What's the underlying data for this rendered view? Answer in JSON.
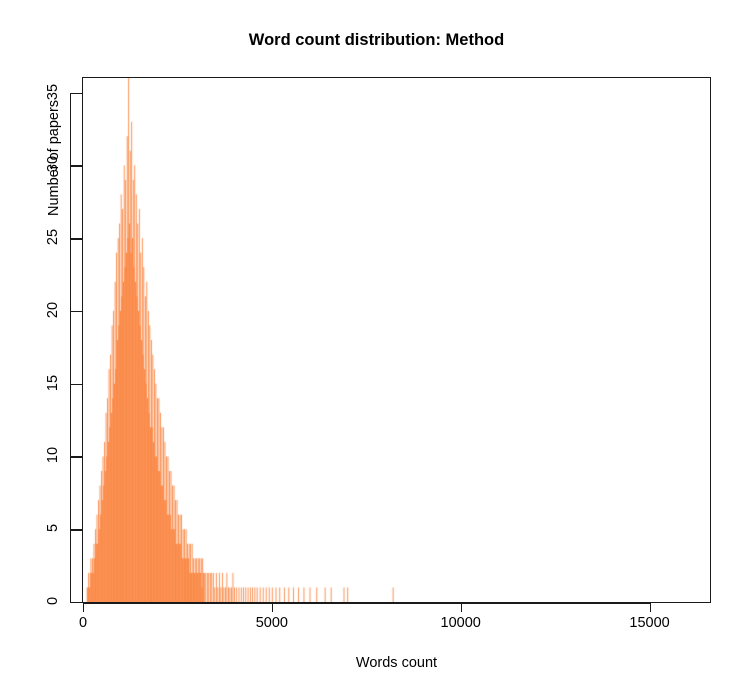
{
  "chart_data": {
    "type": "bar",
    "title": "Word count distribution: Method",
    "xlabel": "Words count",
    "ylabel": "Number of papers",
    "grid": false,
    "legend": null,
    "bar_color": "#f97020",
    "bar_border_color": "#f97020",
    "xlim": [
      0,
      16600
    ],
    "ylim": [
      0,
      36
    ],
    "xticks": [
      0,
      5000,
      10000,
      15000
    ],
    "xtick_labels": [
      "0",
      "5000",
      "10000",
      "15000"
    ],
    "yticks": [
      0,
      5,
      10,
      15,
      20,
      25,
      30,
      35
    ],
    "ytick_labels": [
      "0",
      "5",
      "10",
      "15",
      "20",
      "25",
      "30",
      "35"
    ],
    "bin_width": 20,
    "note": "Fine-binned histogram of method-section word counts; strongly right-skewed, peak near 1200-1400 words, sparse single-paper tail out to ~8200 words.",
    "bins": [
      {
        "x": 100,
        "y": 1
      },
      {
        "x": 120,
        "y": 1
      },
      {
        "x": 140,
        "y": 2
      },
      {
        "x": 160,
        "y": 1
      },
      {
        "x": 180,
        "y": 2
      },
      {
        "x": 200,
        "y": 3
      },
      {
        "x": 220,
        "y": 2
      },
      {
        "x": 240,
        "y": 3
      },
      {
        "x": 260,
        "y": 2
      },
      {
        "x": 280,
        "y": 4
      },
      {
        "x": 300,
        "y": 3
      },
      {
        "x": 320,
        "y": 5
      },
      {
        "x": 340,
        "y": 4
      },
      {
        "x": 360,
        "y": 6
      },
      {
        "x": 380,
        "y": 4
      },
      {
        "x": 400,
        "y": 7
      },
      {
        "x": 420,
        "y": 5
      },
      {
        "x": 440,
        "y": 8
      },
      {
        "x": 460,
        "y": 6
      },
      {
        "x": 480,
        "y": 9
      },
      {
        "x": 500,
        "y": 7
      },
      {
        "x": 520,
        "y": 10
      },
      {
        "x": 540,
        "y": 8
      },
      {
        "x": 560,
        "y": 11
      },
      {
        "x": 580,
        "y": 9
      },
      {
        "x": 600,
        "y": 13
      },
      {
        "x": 620,
        "y": 10
      },
      {
        "x": 640,
        "y": 14
      },
      {
        "x": 660,
        "y": 11
      },
      {
        "x": 680,
        "y": 16
      },
      {
        "x": 700,
        "y": 12
      },
      {
        "x": 720,
        "y": 17
      },
      {
        "x": 740,
        "y": 13
      },
      {
        "x": 760,
        "y": 19
      },
      {
        "x": 780,
        "y": 14
      },
      {
        "x": 800,
        "y": 20
      },
      {
        "x": 820,
        "y": 15
      },
      {
        "x": 840,
        "y": 22
      },
      {
        "x": 860,
        "y": 16
      },
      {
        "x": 880,
        "y": 24
      },
      {
        "x": 900,
        "y": 18
      },
      {
        "x": 920,
        "y": 25
      },
      {
        "x": 940,
        "y": 19
      },
      {
        "x": 960,
        "y": 26
      },
      {
        "x": 980,
        "y": 20
      },
      {
        "x": 1000,
        "y": 28
      },
      {
        "x": 1020,
        "y": 21
      },
      {
        "x": 1040,
        "y": 27
      },
      {
        "x": 1060,
        "y": 22
      },
      {
        "x": 1080,
        "y": 30
      },
      {
        "x": 1100,
        "y": 23
      },
      {
        "x": 1120,
        "y": 29
      },
      {
        "x": 1140,
        "y": 24
      },
      {
        "x": 1160,
        "y": 32
      },
      {
        "x": 1180,
        "y": 25
      },
      {
        "x": 1200,
        "y": 36
      },
      {
        "x": 1220,
        "y": 26
      },
      {
        "x": 1240,
        "y": 31
      },
      {
        "x": 1260,
        "y": 24
      },
      {
        "x": 1280,
        "y": 33
      },
      {
        "x": 1300,
        "y": 25
      },
      {
        "x": 1320,
        "y": 29
      },
      {
        "x": 1340,
        "y": 23
      },
      {
        "x": 1360,
        "y": 30
      },
      {
        "x": 1380,
        "y": 22
      },
      {
        "x": 1400,
        "y": 28
      },
      {
        "x": 1420,
        "y": 21
      },
      {
        "x": 1440,
        "y": 26
      },
      {
        "x": 1460,
        "y": 20
      },
      {
        "x": 1480,
        "y": 27
      },
      {
        "x": 1500,
        "y": 19
      },
      {
        "x": 1520,
        "y": 24
      },
      {
        "x": 1540,
        "y": 18
      },
      {
        "x": 1560,
        "y": 25
      },
      {
        "x": 1580,
        "y": 17
      },
      {
        "x": 1600,
        "y": 23
      },
      {
        "x": 1620,
        "y": 16
      },
      {
        "x": 1640,
        "y": 21
      },
      {
        "x": 1660,
        "y": 15
      },
      {
        "x": 1680,
        "y": 22
      },
      {
        "x": 1700,
        "y": 14
      },
      {
        "x": 1720,
        "y": 20
      },
      {
        "x": 1740,
        "y": 13
      },
      {
        "x": 1760,
        "y": 19
      },
      {
        "x": 1780,
        "y": 12
      },
      {
        "x": 1800,
        "y": 18
      },
      {
        "x": 1820,
        "y": 12
      },
      {
        "x": 1840,
        "y": 17
      },
      {
        "x": 1860,
        "y": 11
      },
      {
        "x": 1880,
        "y": 16
      },
      {
        "x": 1900,
        "y": 10
      },
      {
        "x": 1920,
        "y": 15
      },
      {
        "x": 1940,
        "y": 10
      },
      {
        "x": 1960,
        "y": 14
      },
      {
        "x": 1980,
        "y": 9
      },
      {
        "x": 2000,
        "y": 14
      },
      {
        "x": 2020,
        "y": 9
      },
      {
        "x": 2040,
        "y": 13
      },
      {
        "x": 2060,
        "y": 8
      },
      {
        "x": 2080,
        "y": 12
      },
      {
        "x": 2100,
        "y": 8
      },
      {
        "x": 2120,
        "y": 12
      },
      {
        "x": 2140,
        "y": 7
      },
      {
        "x": 2160,
        "y": 11
      },
      {
        "x": 2180,
        "y": 7
      },
      {
        "x": 2200,
        "y": 10
      },
      {
        "x": 2220,
        "y": 6
      },
      {
        "x": 2240,
        "y": 10
      },
      {
        "x": 2260,
        "y": 6
      },
      {
        "x": 2280,
        "y": 9
      },
      {
        "x": 2300,
        "y": 6
      },
      {
        "x": 2320,
        "y": 9
      },
      {
        "x": 2340,
        "y": 5
      },
      {
        "x": 2360,
        "y": 8
      },
      {
        "x": 2380,
        "y": 5
      },
      {
        "x": 2400,
        "y": 8
      },
      {
        "x": 2420,
        "y": 5
      },
      {
        "x": 2440,
        "y": 7
      },
      {
        "x": 2460,
        "y": 4
      },
      {
        "x": 2480,
        "y": 7
      },
      {
        "x": 2500,
        "y": 4
      },
      {
        "x": 2520,
        "y": 6
      },
      {
        "x": 2540,
        "y": 4
      },
      {
        "x": 2560,
        "y": 6
      },
      {
        "x": 2580,
        "y": 4
      },
      {
        "x": 2600,
        "y": 6
      },
      {
        "x": 2620,
        "y": 3
      },
      {
        "x": 2640,
        "y": 5
      },
      {
        "x": 2660,
        "y": 3
      },
      {
        "x": 2680,
        "y": 5
      },
      {
        "x": 2700,
        "y": 3
      },
      {
        "x": 2720,
        "y": 5
      },
      {
        "x": 2740,
        "y": 3
      },
      {
        "x": 2760,
        "y": 4
      },
      {
        "x": 2780,
        "y": 3
      },
      {
        "x": 2800,
        "y": 4
      },
      {
        "x": 2820,
        "y": 2
      },
      {
        "x": 2840,
        "y": 4
      },
      {
        "x": 2860,
        "y": 2
      },
      {
        "x": 2880,
        "y": 4
      },
      {
        "x": 2900,
        "y": 2
      },
      {
        "x": 2920,
        "y": 3
      },
      {
        "x": 2940,
        "y": 2
      },
      {
        "x": 2960,
        "y": 3
      },
      {
        "x": 2980,
        "y": 2
      },
      {
        "x": 3000,
        "y": 3
      },
      {
        "x": 3020,
        "y": 2
      },
      {
        "x": 3040,
        "y": 3
      },
      {
        "x": 3060,
        "y": 2
      },
      {
        "x": 3080,
        "y": 3
      },
      {
        "x": 3100,
        "y": 2
      },
      {
        "x": 3120,
        "y": 3
      },
      {
        "x": 3140,
        "y": 1
      },
      {
        "x": 3160,
        "y": 3
      },
      {
        "x": 3180,
        "y": 2
      },
      {
        "x": 3200,
        "y": 2
      },
      {
        "x": 3240,
        "y": 2
      },
      {
        "x": 3280,
        "y": 2
      },
      {
        "x": 3320,
        "y": 2
      },
      {
        "x": 3360,
        "y": 2
      },
      {
        "x": 3400,
        "y": 2
      },
      {
        "x": 3440,
        "y": 2
      },
      {
        "x": 3480,
        "y": 1
      },
      {
        "x": 3520,
        "y": 2
      },
      {
        "x": 3560,
        "y": 1
      },
      {
        "x": 3600,
        "y": 2
      },
      {
        "x": 3640,
        "y": 1
      },
      {
        "x": 3680,
        "y": 2
      },
      {
        "x": 3720,
        "y": 1
      },
      {
        "x": 3760,
        "y": 1
      },
      {
        "x": 3800,
        "y": 2
      },
      {
        "x": 3840,
        "y": 1
      },
      {
        "x": 3880,
        "y": 1
      },
      {
        "x": 3920,
        "y": 1
      },
      {
        "x": 3960,
        "y": 2
      },
      {
        "x": 4000,
        "y": 1
      },
      {
        "x": 4060,
        "y": 1
      },
      {
        "x": 4120,
        "y": 1
      },
      {
        "x": 4180,
        "y": 1
      },
      {
        "x": 4240,
        "y": 1
      },
      {
        "x": 4300,
        "y": 1
      },
      {
        "x": 4360,
        "y": 1
      },
      {
        "x": 4420,
        "y": 1
      },
      {
        "x": 4480,
        "y": 1
      },
      {
        "x": 4540,
        "y": 1
      },
      {
        "x": 4600,
        "y": 1
      },
      {
        "x": 4680,
        "y": 1
      },
      {
        "x": 4760,
        "y": 1
      },
      {
        "x": 4840,
        "y": 1
      },
      {
        "x": 4920,
        "y": 1
      },
      {
        "x": 5000,
        "y": 1
      },
      {
        "x": 5100,
        "y": 1
      },
      {
        "x": 5200,
        "y": 1
      },
      {
        "x": 5320,
        "y": 1
      },
      {
        "x": 5440,
        "y": 1
      },
      {
        "x": 5560,
        "y": 1
      },
      {
        "x": 5700,
        "y": 1
      },
      {
        "x": 5840,
        "y": 1
      },
      {
        "x": 6000,
        "y": 1
      },
      {
        "x": 6180,
        "y": 1
      },
      {
        "x": 6400,
        "y": 1
      },
      {
        "x": 6560,
        "y": 1
      },
      {
        "x": 6900,
        "y": 1
      },
      {
        "x": 7000,
        "y": 1
      },
      {
        "x": 8200,
        "y": 1
      }
    ]
  }
}
